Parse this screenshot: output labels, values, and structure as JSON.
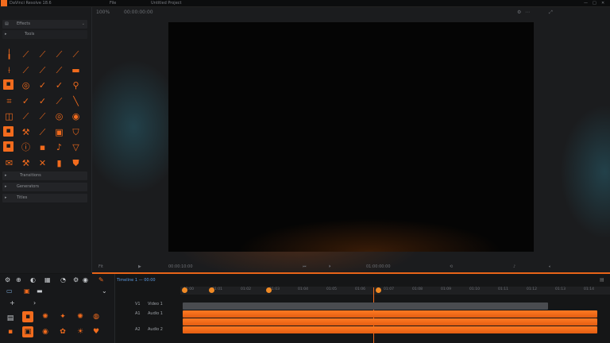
{
  "titlebar": {
    "app_name": "DaVinci Resolve 18.6",
    "menu_item": "File",
    "project_tab": "Untitled Project",
    "window_controls": [
      "—",
      "□",
      "✕"
    ]
  },
  "left_panel": {
    "row1_label": "Effects",
    "row2_label": "Tools",
    "row3_label": "Transitions",
    "row4_label": "Generators",
    "row5_label": "Titles"
  },
  "tools": [
    {
      "icon": "pen-icon",
      "glyph": "╽"
    },
    {
      "icon": "line-icon",
      "glyph": "⟋"
    },
    {
      "icon": "line-icon",
      "glyph": "⟋"
    },
    {
      "icon": "line-icon",
      "glyph": "⟋"
    },
    {
      "icon": "line-icon",
      "glyph": "⟋"
    },
    {
      "icon": "brush-icon",
      "glyph": "⟊"
    },
    {
      "icon": "line-icon",
      "glyph": "⟋"
    },
    {
      "icon": "line-icon",
      "glyph": "⟋"
    },
    {
      "icon": "line-icon",
      "glyph": "⟋"
    },
    {
      "icon": "line-icon",
      "glyph": "▬"
    },
    {
      "icon": "square-icon",
      "glyph": "▪"
    },
    {
      "icon": "eye-icon",
      "glyph": "◎"
    },
    {
      "icon": "check-icon",
      "glyph": "✓"
    },
    {
      "icon": "check-icon",
      "glyph": "✓"
    },
    {
      "icon": "wrench-icon",
      "glyph": "⚲"
    },
    {
      "icon": "crop-icon",
      "glyph": "⌗"
    },
    {
      "icon": "check-icon",
      "glyph": "✓"
    },
    {
      "icon": "check-icon",
      "glyph": "✓"
    },
    {
      "icon": "line-icon",
      "glyph": "⟋"
    },
    {
      "icon": "line-icon",
      "glyph": "╲"
    },
    {
      "icon": "frame-icon",
      "glyph": "◫"
    },
    {
      "icon": "line-icon",
      "glyph": "⟋"
    },
    {
      "icon": "line-icon",
      "glyph": "⟋"
    },
    {
      "icon": "circle-icon",
      "glyph": "◎"
    },
    {
      "icon": "eye-icon",
      "glyph": "◉"
    },
    {
      "icon": "square-icon",
      "glyph": "▪"
    },
    {
      "icon": "hammer-icon",
      "glyph": "⚒"
    },
    {
      "icon": "line-icon",
      "glyph": "⟋"
    },
    {
      "icon": "box-icon",
      "glyph": "▣"
    },
    {
      "icon": "shield-icon",
      "glyph": "⛉"
    },
    {
      "icon": "square-icon",
      "glyph": "▪"
    },
    {
      "icon": "info-icon",
      "glyph": "ⓘ"
    },
    {
      "icon": "square-icon",
      "glyph": "▪"
    },
    {
      "icon": "note-icon",
      "glyph": "♪"
    },
    {
      "icon": "triangle-icon",
      "glyph": "▽"
    },
    {
      "icon": "mail-icon",
      "glyph": "✉"
    },
    {
      "icon": "hammer-icon",
      "glyph": "⚒"
    },
    {
      "icon": "cross-icon",
      "glyph": "✕"
    },
    {
      "icon": "bar-icon",
      "glyph": "▮"
    },
    {
      "icon": "shield-icon",
      "glyph": "⛊"
    }
  ],
  "viewer": {
    "zoom": "100%",
    "timecode_left": "00:00:00:00",
    "fit_label": "Fit",
    "timecode_center": "01:00:00:00",
    "timecode_right": "00:00:10:00"
  },
  "timeline": {
    "header_label": "Timeline 1 — 00:00",
    "ticks": [
      "01:00",
      "01:01",
      "01:02",
      "01:03",
      "01:04",
      "01:05",
      "01:06",
      "01:07",
      "01:08",
      "01:09",
      "01:10",
      "01:11",
      "01:12",
      "01:13",
      "01:14"
    ],
    "tracks": [
      {
        "label": "V1",
        "name": "Video 1"
      },
      {
        "label": "A1",
        "name": "Audio 1"
      },
      {
        "label": "A2",
        "name": "Audio 2"
      }
    ]
  },
  "colors": {
    "accent": "#f26b1d",
    "panel": "#1a1b1d",
    "canvas": "#050505"
  }
}
